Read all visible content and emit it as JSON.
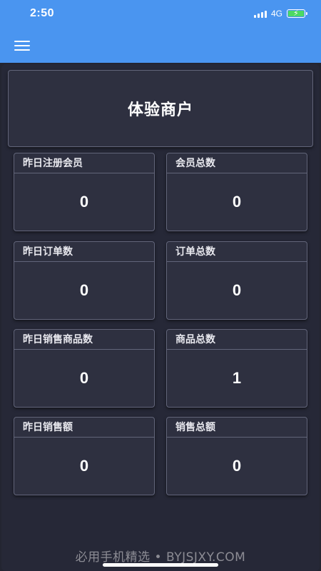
{
  "status_bar": {
    "time": "2:50",
    "network": "4G",
    "icons": [
      "signal-icon",
      "battery-charging-icon"
    ]
  },
  "header": {
    "menu_icon": "hamburger-menu-icon",
    "accent": "#4a95f0"
  },
  "merchant": {
    "name": "体验商户"
  },
  "stats": [
    {
      "label": "昨日注册会员",
      "value": "0"
    },
    {
      "label": "会员总数",
      "value": "0"
    },
    {
      "label": "昨日订单数",
      "value": "0"
    },
    {
      "label": "订单总数",
      "value": "0"
    },
    {
      "label": "昨日销售商品数",
      "value": "0"
    },
    {
      "label": "商品总数",
      "value": "1"
    },
    {
      "label": "昨日销售额",
      "value": "0"
    },
    {
      "label": "销售总额",
      "value": "0"
    }
  ],
  "watermark": "必用手机精选 • BYJSJXY.COM"
}
